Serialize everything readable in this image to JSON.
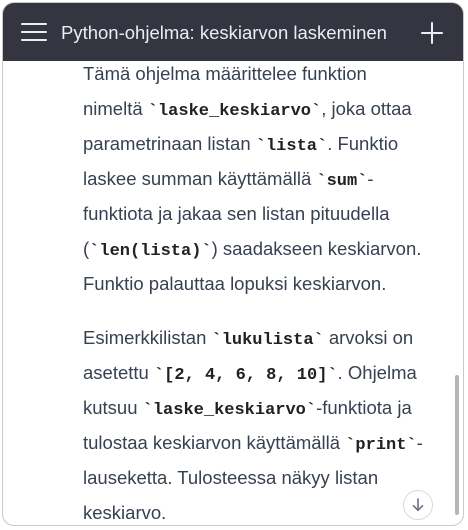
{
  "header": {
    "title": "Python-ohjelma: keskiarvon laskeminen",
    "menu_icon": "hamburger-menu-icon",
    "new_chat_icon": "plus-icon"
  },
  "message": {
    "paragraph1": {
      "line1": {
        "t1": "Tämä ohjelma määrittelee funktion"
      },
      "line2": {
        "t1": "nimeltä ",
        "c1": "`laske_keskiarvo`",
        "t2": ", joka ottaa"
      },
      "line3": {
        "t1": "parametrinaan listan ",
        "c1": "`lista`",
        "t2": ". Funktio"
      },
      "line4": {
        "t1": "laskee summan käyttämällä ",
        "c1": "`sum`",
        "t2": "-"
      },
      "line5": {
        "t1": "funktiota ja jakaa sen listan pituudella"
      },
      "line6": {
        "t1": "(",
        "c1": "`len(lista)`",
        "t2": ") saadakseen keskiarvon."
      },
      "line7": {
        "t1": "Funktio palauttaa lopuksi keskiarvon."
      }
    },
    "paragraph2": {
      "line1": {
        "t1": "Esimerkkilistan ",
        "c1": "`lukulista`",
        "t2": " arvoksi on"
      },
      "line2": {
        "t1": "asetettu ",
        "c1": "`[2, 4, 6, 8, 10]`",
        "t2": ". Ohjelma"
      },
      "line3": {
        "c1": "`laske_keskiarvo`",
        "t0": "kutsuu ",
        "t2": "-funktiota ja"
      },
      "line4": {
        "t1": "tulostaa keskiarvon käyttämällä ",
        "c1": "`print`",
        "t2": "-"
      },
      "line5": {
        "t1": "lauseketta. Tulosteessa näkyy listan"
      },
      "line6": {
        "t1": "keskiarvo."
      }
    }
  },
  "scroll_down_icon": "arrow-down-icon",
  "colors": {
    "header_bg": "#343541",
    "header_text": "#ececf1",
    "body_text": "#374151"
  }
}
